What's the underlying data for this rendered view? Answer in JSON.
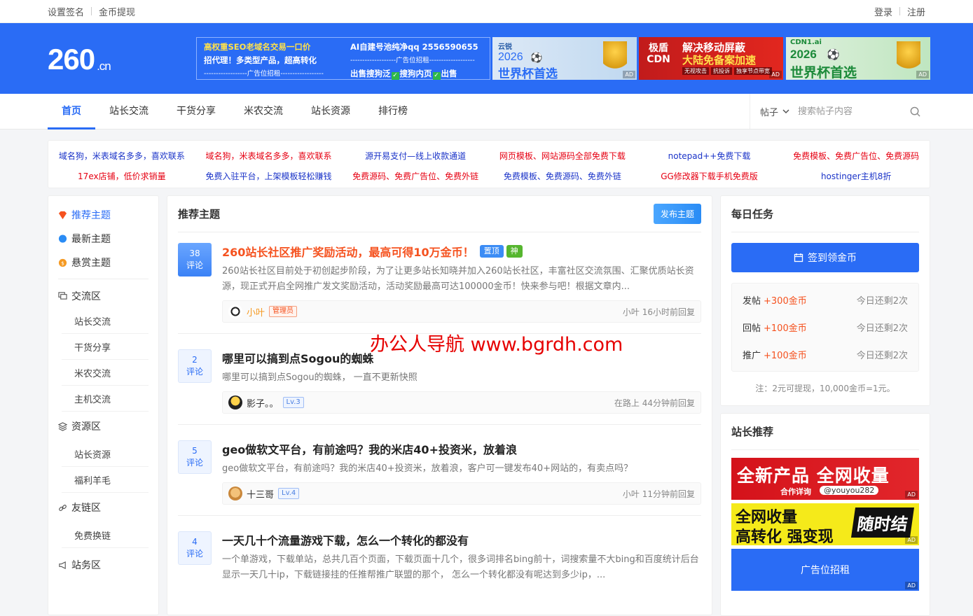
{
  "topbar": {
    "left": [
      "设置签名",
      "金币提现"
    ],
    "right": [
      "登录",
      "注册"
    ]
  },
  "logo": {
    "main": "260",
    "suffix": ".cn"
  },
  "banner_text_ad": {
    "col1": [
      "高权重SEO老域名交易一口价",
      "招代理！多类型产品，超高转化",
      "------------------广告位招租------------------"
    ],
    "col2_line1": "AI自建号池纯净qq 2556590655",
    "col2_line2": "-------------------广告位招租-------------------",
    "col2_line3_a": "出售搜狗泛",
    "col2_line3_b": "搜狗内页",
    "col2_line3_c": "出售"
  },
  "banner_ads": [
    {
      "brand": "云锐",
      "line1": "2026",
      "line2": "世界杯首选",
      "tag": "AD"
    },
    {
      "brand": "极盾 CDN",
      "line1": "解决移动屏蔽",
      "line2": "大陆免备案加速",
      "chips": [
        "无视攻击",
        "抗投诉",
        "独享节点带宽"
      ],
      "tag": "AD"
    },
    {
      "brand": "CDN1.ai",
      "line1": "2026",
      "line2": "世界杯首选",
      "tag": "AD"
    }
  ],
  "nav": {
    "items": [
      "首页",
      "站长交流",
      "干货分享",
      "米农交流",
      "站长资源",
      "排行榜"
    ],
    "search_scope": "帖子",
    "search_placeholder": "搜索帖子内容"
  },
  "links": [
    {
      "text": "域名狗，米表域名多多，喜欢联系",
      "color": "#1a33c8"
    },
    {
      "text": "域名狗，米表域名多多，喜欢联系",
      "color": "#e60012"
    },
    {
      "text": "源开易支付—线上收款通道",
      "color": "#1a33c8"
    },
    {
      "text": "网页模板、网站源码全部免费下载",
      "color": "#e60012"
    },
    {
      "text": "notepad++免费下载",
      "color": "#1a33c8"
    },
    {
      "text": "免费模板、免费广告位、免费源码",
      "color": "#e60012"
    },
    {
      "text": "17ex店铺，低价求销量",
      "color": "#e60012"
    },
    {
      "text": "免费入驻平台，上架模板轻松赚钱",
      "color": "#1a33c8"
    },
    {
      "text": "免费源码、免费广告位、免费外链",
      "color": "#e60012"
    },
    {
      "text": "免费模板、免费源码、免费外链",
      "color": "#1a33c8"
    },
    {
      "text": "GG修改器下载手机免费版",
      "color": "#e60012"
    },
    {
      "text": "hostinger主机8折",
      "color": "#1a33c8"
    }
  ],
  "sidebar": {
    "top": [
      "推荐主题",
      "最新主题",
      "悬赏主题"
    ],
    "sections": [
      {
        "title": "交流区",
        "items": [
          "站长交流",
          "干货分享",
          "米农交流",
          "主机交流"
        ]
      },
      {
        "title": "资源区",
        "items": [
          "站长资源",
          "福利羊毛"
        ]
      },
      {
        "title": "友链区",
        "items": [
          "免费换链"
        ]
      },
      {
        "title": "站务区",
        "items": []
      }
    ]
  },
  "main": {
    "title": "推荐主题",
    "post_button": "发布主题",
    "comment_label": "评论",
    "posts": [
      {
        "count": "38",
        "title": "260站长社区推广奖励活动，最高可得10万金币！",
        "tags": [
          "置顶",
          "神"
        ],
        "excerpt": "260站长社区目前处于初创起步阶段，为了让更多站长知晓并加入260站长社区，丰富社区交流氛围、汇聚优质站长资源，现正式开启全网推广发文奖励活动，活动奖励最高可达100000金币！快来参与吧！根据文章内...",
        "author": "小叶",
        "role": "管理员",
        "reply": "小叶 16小时前回复"
      },
      {
        "count": "2",
        "title": "哪里可以搞到点Sogou的蜘蛛",
        "excerpt": "哪里可以搞到点Sogou的蜘蛛， 一直不更新快照",
        "author": "影子。。",
        "role": "Lv.3",
        "reply": "在路上 44分钟前回复"
      },
      {
        "count": "5",
        "title": "geo做软文平台，有前途吗？我的米店40+投资米，放着浪",
        "excerpt": "geo做软文平台，有前途吗？我的米店40+投资米，放着浪，客户可一键发布40+网站的，有卖点吗？",
        "author": "十三哥",
        "role": "Lv.4",
        "reply": "小叶 11分钟前回复"
      },
      {
        "count": "4",
        "title": "一天几十个流量游戏下载，怎么一个转化的都没有",
        "excerpt": "一个单游戏，下载单站，总共几百个页面，下载页面十几个，很多词排名bing前十，词搜索量不大bing和百度统计后台显示一天几十ip，下载链接挂的任推帮推广联盟的那个， 怎么一个转化都没有呢达到多少ip，..."
      }
    ]
  },
  "daily": {
    "title": "每日任务",
    "sign_button": "签到领金币",
    "tasks": [
      {
        "name": "发帖",
        "reward": "+300金币",
        "remain": "今日还剩2次"
      },
      {
        "name": "回帖",
        "reward": "+100金币",
        "remain": "今日还剩2次"
      },
      {
        "name": "推广",
        "reward": "+100金币",
        "remain": "今日还剩2次"
      }
    ],
    "note": "注：2元可提现，10,000金币=1元。"
  },
  "recommend": {
    "title": "站长推荐",
    "ad1_line1": "全新产品 全网收量",
    "ad1_line2": "合作详询",
    "ad1_handle": "@youyou282",
    "ad2_line1": "全网收量",
    "ad2_line2": "高转化 强变现",
    "ad2_badge": "随时结",
    "ad3": "广告位招租",
    "ad_tag": "AD"
  },
  "watermark": "办公人导航  www.bgrdh.com",
  "colors": {
    "brand": "#2a6cf5",
    "hot": "#f5521f"
  }
}
